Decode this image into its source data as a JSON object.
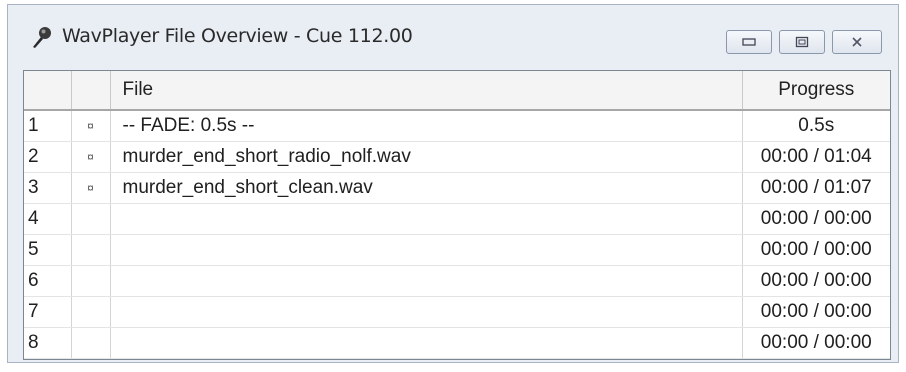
{
  "window": {
    "title": "WavPlayer File Overview - Cue 112.00",
    "icon": "mic-icon",
    "controls": [
      "minimize-icon",
      "restore-icon",
      "close-icon"
    ]
  },
  "table": {
    "headers": {
      "num": "",
      "state": "",
      "file": "File",
      "progress": "Progress"
    },
    "rows": [
      {
        "num": "1",
        "state": "¤",
        "file": "-- FADE: 0.5s --",
        "progress": "0.5s"
      },
      {
        "num": "2",
        "state": "¤",
        "file": "murder_end_short_radio_nolf.wav",
        "progress": "00:00 / 01:04"
      },
      {
        "num": "3",
        "state": "¤",
        "file": "murder_end_short_clean.wav",
        "progress": "00:00 / 01:07"
      },
      {
        "num": "4",
        "state": "",
        "file": "",
        "progress": "00:00 / 00:00"
      },
      {
        "num": "5",
        "state": "",
        "file": "",
        "progress": "00:00 / 00:00"
      },
      {
        "num": "6",
        "state": "",
        "file": "",
        "progress": "00:00 / 00:00"
      },
      {
        "num": "7",
        "state": "",
        "file": "",
        "progress": "00:00 / 00:00"
      },
      {
        "num": "8",
        "state": "",
        "file": "",
        "progress": "00:00 / 00:00"
      }
    ]
  }
}
